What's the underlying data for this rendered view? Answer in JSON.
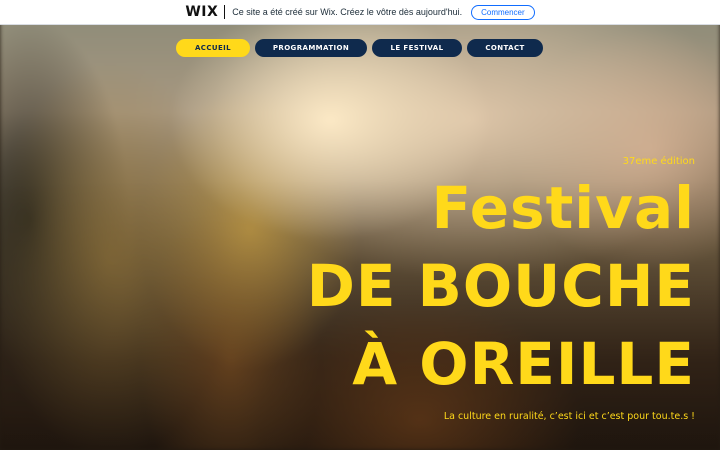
{
  "wix_banner": {
    "logo": "WIX",
    "message": "Ce site a été créé sur Wix. Créez le vôtre dès aujourd'hui.",
    "cta_label": "Commencer"
  },
  "nav": {
    "items": [
      {
        "label": "ACCUEIL",
        "active": true
      },
      {
        "label": "PROGRAMMATION",
        "active": false
      },
      {
        "label": "LE FESTIVAL",
        "active": false
      },
      {
        "label": "CONTACT",
        "active": false
      }
    ]
  },
  "hero": {
    "edition": "37eme édition",
    "title_lines": [
      "Festival",
      "DE BOUCHE",
      "À OREILLE"
    ],
    "tagline": "La culture en ruralité, c’est ici et c’est pour tou.te.s !"
  },
  "colors": {
    "accent_yellow": "#ffd91a",
    "nav_navy": "#0f2a4d",
    "wix_blue": "#116dff"
  }
}
